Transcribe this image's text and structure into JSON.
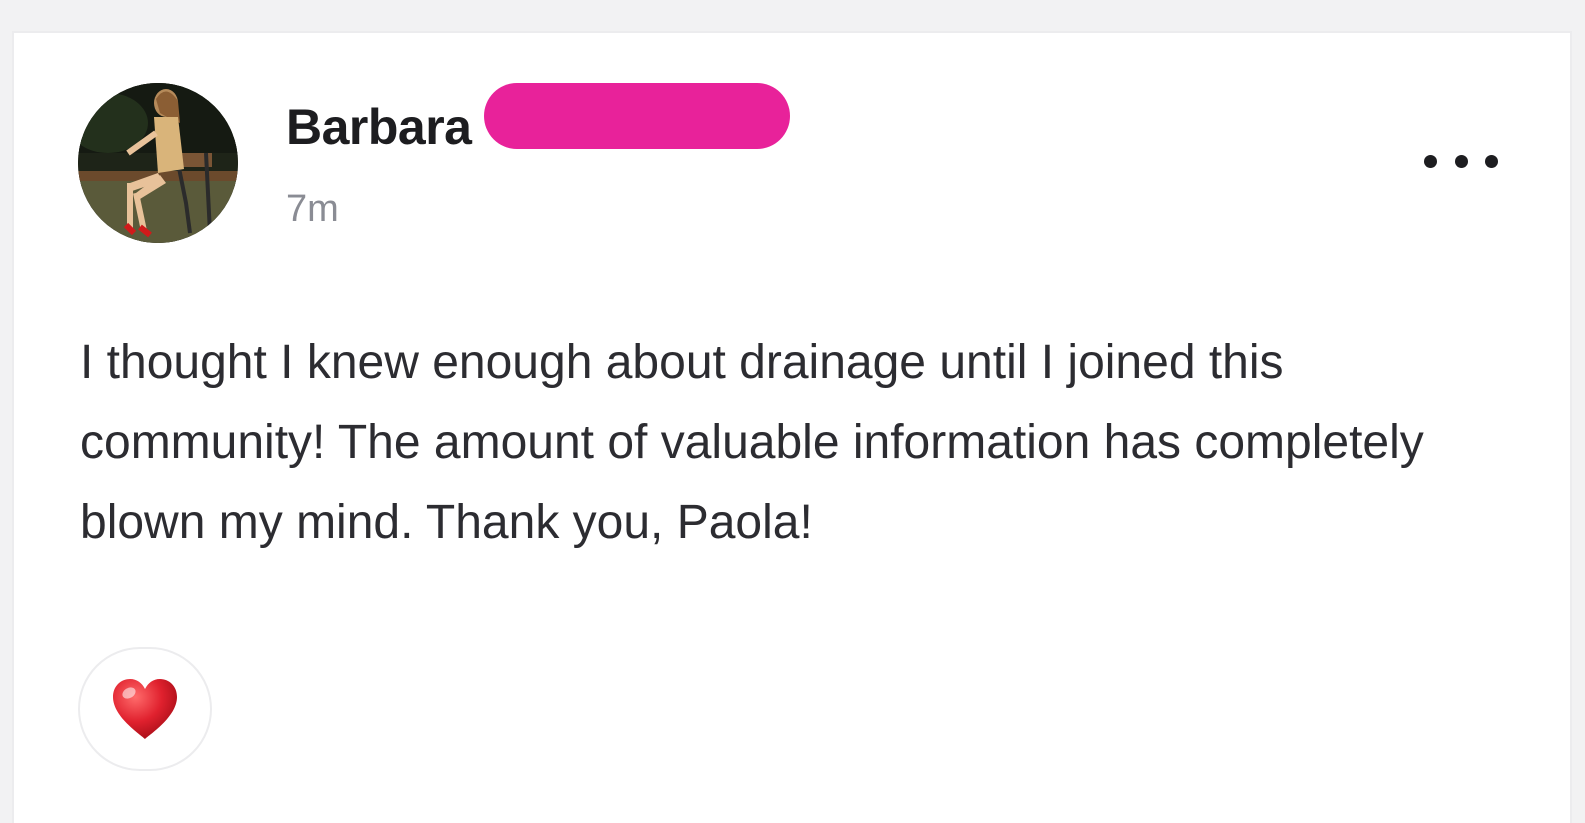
{
  "post": {
    "author": {
      "first_name": "Barbara",
      "name_redacted": true,
      "redaction_color": "#e8229a"
    },
    "timestamp": "7m",
    "body": "I thought I knew enough about drainage until I joined this community! The amount of valuable information has completely blown my mind. Thank you, Paola!",
    "more_icon": "more-horizontal-icon",
    "reaction": {
      "icon": "heart-icon",
      "color": "#e0212e"
    }
  },
  "colors": {
    "background": "#f2f2f3",
    "card": "#ffffff",
    "text": "#2c2c31",
    "muted": "#8a8c94"
  }
}
